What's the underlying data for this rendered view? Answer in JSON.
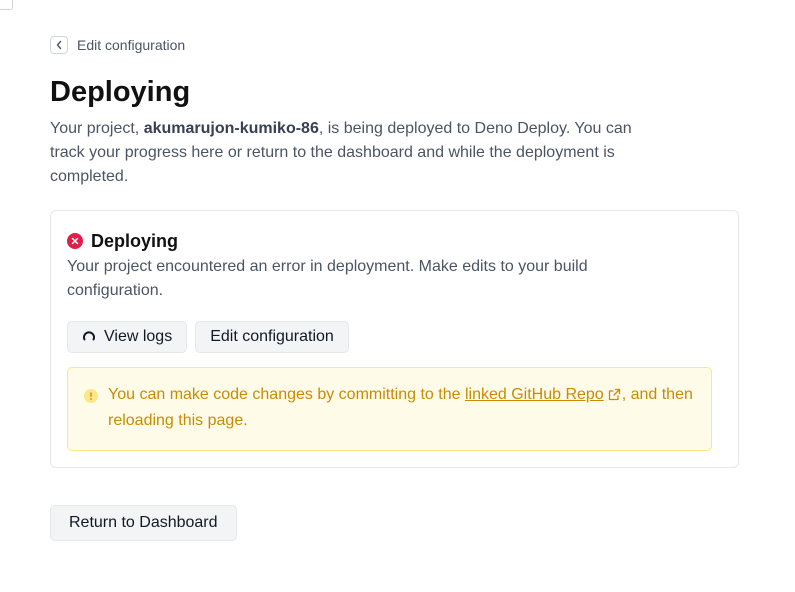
{
  "header": {
    "back_label": "Edit configuration"
  },
  "page": {
    "title": "Deploying",
    "intro_prefix": "Your project, ",
    "project_name": "akumarujon-kumiko-86",
    "intro_suffix": ", is being deployed to Deno Deploy. You can track your progress here or return to the dashboard and while the deployment is completed."
  },
  "status": {
    "title": "Deploying",
    "message": "Your project encountered an error in deployment. Make edits to your build configuration.",
    "icon": "error-x-icon",
    "color": "#e11d48"
  },
  "actions": {
    "view_logs_label": "View logs",
    "edit_config_label": "Edit configuration"
  },
  "notice": {
    "text_before": "You can make code changes by committing to the ",
    "link_text": "linked GitHub Repo",
    "text_after": ", and then reloading this page.",
    "color": "#ca8a04"
  },
  "footer": {
    "return_label": "Return to Dashboard"
  }
}
